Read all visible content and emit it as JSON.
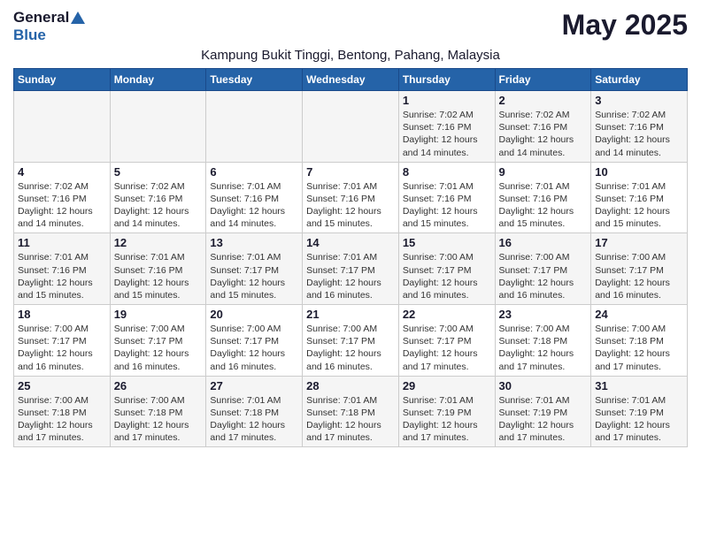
{
  "logo": {
    "general": "General",
    "blue": "Blue"
  },
  "title": "May 2025",
  "subtitle": "Kampung Bukit Tinggi, Bentong, Pahang, Malaysia",
  "days_of_week": [
    "Sunday",
    "Monday",
    "Tuesday",
    "Wednesday",
    "Thursday",
    "Friday",
    "Saturday"
  ],
  "weeks": [
    [
      {
        "day": "",
        "info": ""
      },
      {
        "day": "",
        "info": ""
      },
      {
        "day": "",
        "info": ""
      },
      {
        "day": "",
        "info": ""
      },
      {
        "day": "1",
        "info": "Sunrise: 7:02 AM\nSunset: 7:16 PM\nDaylight: 12 hours\nand 14 minutes."
      },
      {
        "day": "2",
        "info": "Sunrise: 7:02 AM\nSunset: 7:16 PM\nDaylight: 12 hours\nand 14 minutes."
      },
      {
        "day": "3",
        "info": "Sunrise: 7:02 AM\nSunset: 7:16 PM\nDaylight: 12 hours\nand 14 minutes."
      }
    ],
    [
      {
        "day": "4",
        "info": "Sunrise: 7:02 AM\nSunset: 7:16 PM\nDaylight: 12 hours\nand 14 minutes."
      },
      {
        "day": "5",
        "info": "Sunrise: 7:02 AM\nSunset: 7:16 PM\nDaylight: 12 hours\nand 14 minutes."
      },
      {
        "day": "6",
        "info": "Sunrise: 7:01 AM\nSunset: 7:16 PM\nDaylight: 12 hours\nand 14 minutes."
      },
      {
        "day": "7",
        "info": "Sunrise: 7:01 AM\nSunset: 7:16 PM\nDaylight: 12 hours\nand 15 minutes."
      },
      {
        "day": "8",
        "info": "Sunrise: 7:01 AM\nSunset: 7:16 PM\nDaylight: 12 hours\nand 15 minutes."
      },
      {
        "day": "9",
        "info": "Sunrise: 7:01 AM\nSunset: 7:16 PM\nDaylight: 12 hours\nand 15 minutes."
      },
      {
        "day": "10",
        "info": "Sunrise: 7:01 AM\nSunset: 7:16 PM\nDaylight: 12 hours\nand 15 minutes."
      }
    ],
    [
      {
        "day": "11",
        "info": "Sunrise: 7:01 AM\nSunset: 7:16 PM\nDaylight: 12 hours\nand 15 minutes."
      },
      {
        "day": "12",
        "info": "Sunrise: 7:01 AM\nSunset: 7:16 PM\nDaylight: 12 hours\nand 15 minutes."
      },
      {
        "day": "13",
        "info": "Sunrise: 7:01 AM\nSunset: 7:17 PM\nDaylight: 12 hours\nand 15 minutes."
      },
      {
        "day": "14",
        "info": "Sunrise: 7:01 AM\nSunset: 7:17 PM\nDaylight: 12 hours\nand 16 minutes."
      },
      {
        "day": "15",
        "info": "Sunrise: 7:00 AM\nSunset: 7:17 PM\nDaylight: 12 hours\nand 16 minutes."
      },
      {
        "day": "16",
        "info": "Sunrise: 7:00 AM\nSunset: 7:17 PM\nDaylight: 12 hours\nand 16 minutes."
      },
      {
        "day": "17",
        "info": "Sunrise: 7:00 AM\nSunset: 7:17 PM\nDaylight: 12 hours\nand 16 minutes."
      }
    ],
    [
      {
        "day": "18",
        "info": "Sunrise: 7:00 AM\nSunset: 7:17 PM\nDaylight: 12 hours\nand 16 minutes."
      },
      {
        "day": "19",
        "info": "Sunrise: 7:00 AM\nSunset: 7:17 PM\nDaylight: 12 hours\nand 16 minutes."
      },
      {
        "day": "20",
        "info": "Sunrise: 7:00 AM\nSunset: 7:17 PM\nDaylight: 12 hours\nand 16 minutes."
      },
      {
        "day": "21",
        "info": "Sunrise: 7:00 AM\nSunset: 7:17 PM\nDaylight: 12 hours\nand 16 minutes."
      },
      {
        "day": "22",
        "info": "Sunrise: 7:00 AM\nSunset: 7:17 PM\nDaylight: 12 hours\nand 17 minutes."
      },
      {
        "day": "23",
        "info": "Sunrise: 7:00 AM\nSunset: 7:18 PM\nDaylight: 12 hours\nand 17 minutes."
      },
      {
        "day": "24",
        "info": "Sunrise: 7:00 AM\nSunset: 7:18 PM\nDaylight: 12 hours\nand 17 minutes."
      }
    ],
    [
      {
        "day": "25",
        "info": "Sunrise: 7:00 AM\nSunset: 7:18 PM\nDaylight: 12 hours\nand 17 minutes."
      },
      {
        "day": "26",
        "info": "Sunrise: 7:00 AM\nSunset: 7:18 PM\nDaylight: 12 hours\nand 17 minutes."
      },
      {
        "day": "27",
        "info": "Sunrise: 7:01 AM\nSunset: 7:18 PM\nDaylight: 12 hours\nand 17 minutes."
      },
      {
        "day": "28",
        "info": "Sunrise: 7:01 AM\nSunset: 7:18 PM\nDaylight: 12 hours\nand 17 minutes."
      },
      {
        "day": "29",
        "info": "Sunrise: 7:01 AM\nSunset: 7:19 PM\nDaylight: 12 hours\nand 17 minutes."
      },
      {
        "day": "30",
        "info": "Sunrise: 7:01 AM\nSunset: 7:19 PM\nDaylight: 12 hours\nand 17 minutes."
      },
      {
        "day": "31",
        "info": "Sunrise: 7:01 AM\nSunset: 7:19 PM\nDaylight: 12 hours\nand 17 minutes."
      }
    ]
  ]
}
